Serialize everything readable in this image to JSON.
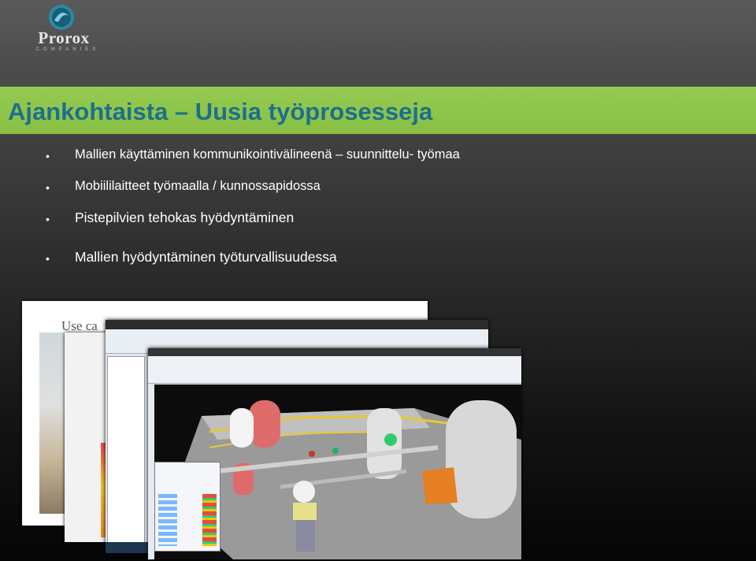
{
  "logo": {
    "name": "Prorox",
    "tagline": "COMPANIES"
  },
  "slide": {
    "title": "Ajankohtaista – Uusia työprosesseja",
    "bullets": [
      {
        "text": "Mallien käyttäminen kommunikointivälineenä – suunnittelu- työmaa"
      },
      {
        "text": "Mobiililaitteet työmaalla / kunnossapidossa"
      },
      {
        "text": "Pistepilvien tehokas hyödyntäminen"
      },
      {
        "text": "Mallien hyödyntäminen työturvallisuudessa"
      }
    ],
    "bullet_symbol": "•"
  },
  "collage": {
    "back_doc_heading": "Use ca",
    "colors": {
      "green_bar": "#8bc34a",
      "title": "#1d6f8e",
      "vessel_red": "#e06b6b",
      "platform_yellow": "#e8c830"
    }
  }
}
